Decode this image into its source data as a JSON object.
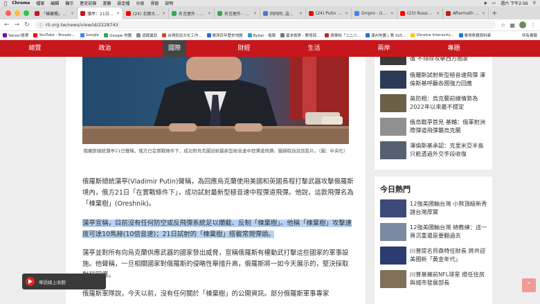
{
  "menubar": {
    "app": "Chrome",
    "items": [
      "檔案",
      "編輯",
      "顯示",
      "歷史記錄",
      "書籤",
      "設定檔",
      "分頁",
      "視窗",
      "說明"
    ],
    "clock": "週六 下午2:56"
  },
  "tabs": [
    {
      "label": "「棟棄暢」飛彈射",
      "color": "#c8161d"
    },
    {
      "label": "蒲亭：21日在烏克",
      "color": "#c8161d",
      "active": true
    },
    {
      "label": "(24) 北韓大軍 參加",
      "color": "#ff0000"
    },
    {
      "label": "名言屋外 - Google",
      "color": "#34a853"
    },
    {
      "label": "名言屋外 - 轉載言",
      "color": "#34a853"
    },
    {
      "label": "同同同..這裏是英",
      "color": "#4a7bd0"
    },
    {
      "label": "(24) Putin says R",
      "color": "#ff0000"
    },
    {
      "label": "Dnipro - Google S",
      "color": "#4285f4"
    },
    {
      "label": "(23) Russia Fires",
      "color": "#ff0000"
    },
    {
      "label": "Aftermath of Ru",
      "color": "#b8211f"
    }
  ],
  "address": {
    "url": "rti.org.tw/news/view/id/2228743"
  },
  "bookmarks": [
    {
      "label": "Yahoo!奇摩",
      "color": "#6b0fb4"
    },
    {
      "label": "YouTube - Broadc...",
      "color": "#ff0000"
    },
    {
      "label": "Google",
      "color": "#4285f4"
    },
    {
      "label": "Google 地圖",
      "color": "#34a853"
    },
    {
      "label": "追蹤巢狀",
      "color": "#888888"
    },
    {
      "label": "台灣民俗文化工作...",
      "color": "#d04a2a"
    },
    {
      "label": "臺灣百年歷史地圖",
      "color": "#2a6ad0"
    },
    {
      "label": "Bybar - 電報",
      "color": "#2a9fd6"
    },
    {
      "label": "基本檢索 - 教育部...",
      "color": "#777777"
    },
    {
      "label": "張東柏「二二八...",
      "color": "#b03030"
    },
    {
      "label": "滿州地圖 | 第 325...",
      "color": "#1a73e8"
    },
    {
      "label": "Ukraine Interactiv...",
      "color": "#ffcc00"
    },
    {
      "label": "臺灣魚類資料庫",
      "color": "#1a73e8"
    }
  ],
  "bookmarks_all": "所有書籤",
  "nav": [
    "總覽",
    "政治",
    "國際",
    "財經",
    "生活",
    "兩岸",
    "專題"
  ],
  "nav_active": "國際",
  "article": {
    "caption": "俄羅斯總統蒲亭21日聲稱，俄方已在實戰條件下，成功對烏克蘭試射最新型極音速中程彈道飛彈。圖擷取自談話影片。（圖：中央社）",
    "p1": "俄羅斯總統蒲亭(Vladimir Putin)聲稱，為回應烏克蘭使用美國和英國長程打擊武器攻擊俄羅斯境內，俄方21日「在實戰條件下」，成功試射最新型極音速中程彈道飛彈。他說，這款飛彈名為「棟棄樹」(Oreshnik)。",
    "p2": "蒲亭宣稱，目前沒有任何防空或反飛彈系統足以攔截、反制「棟棄樹」。他稱「棟棄樹」攻擊速度可達10馬赫(10倍音速)；21日試射的「棟棄樹」搭載常規彈頭。",
    "p3": "蒲亭並對所有向烏克蘭供應武器的國家發出威脅，宣稱俄羅斯有權動武打擊這些國家的軍事設施。他聲稱，一旦相關國家對俄羅斯的侵略性舉措升高，俄羅斯將一如今天展示的，堅決採取對稱回應。",
    "p4": "俄羅斯軍隊說，今天以前，沒有任何關於「棟棄樹」的公開資訊。部分俄羅斯軍事專家"
  },
  "related": [
    {
      "title": "徹 不排除攻擊西方國家",
      "thumb": "#3a3a3a"
    },
    {
      "title": "俄羅斯試射新型極音速飛彈 澤倫斯基呼籲各國強力回應",
      "thumb": "#2b3a55"
    },
    {
      "title": "英防相：烏克蘭前線情勢為2022年以來最不穩定",
      "thumb": "#6b6048"
    },
    {
      "title": "俄烏戰爭首見 基輔：俄軍射洲際彈道飛彈襲烏克蘭",
      "thumb": "#909090"
    },
    {
      "title": "澤倫斯基承認：克里米亞半島只能透過外交手段收復",
      "thumb": "#556070"
    }
  ],
  "hot": {
    "title": "今日熱門",
    "items": [
      {
        "title": "12強美國輸台灣 小熊頂級新秀譜台灣厚實",
        "thumb": "#3b4a78"
      },
      {
        "title": "12強美國輸台灣 總教練：這一頁沉重還是要翻過去",
        "thumb": "#7a8aa0"
      },
      {
        "title": "川普提名貝森特任財長 將共迎美國新「黃金年代」",
        "thumb": "#2c3c70"
      },
      {
        "title": "川普基擁前NFL球星 擔任住房與城市發展部長",
        "thumb": "#80705a"
      }
    ]
  },
  "player": {
    "label": "華語線上收聽"
  }
}
